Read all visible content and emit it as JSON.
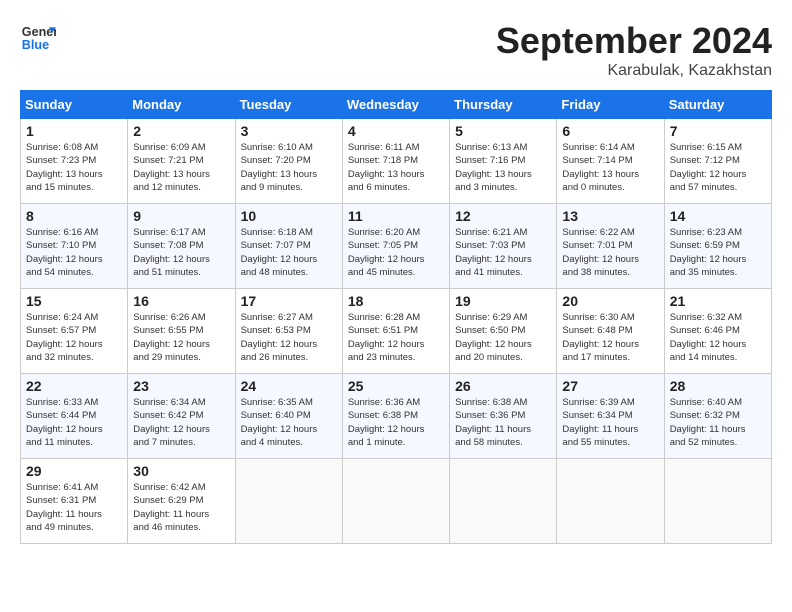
{
  "logo": {
    "line1": "General",
    "line2": "Blue"
  },
  "title": "September 2024",
  "location": "Karabulak, Kazakhstan",
  "weekdays": [
    "Sunday",
    "Monday",
    "Tuesday",
    "Wednesday",
    "Thursday",
    "Friday",
    "Saturday"
  ],
  "days": [
    {
      "day": "",
      "info": ""
    },
    {
      "day": "",
      "info": ""
    },
    {
      "day": "",
      "info": ""
    },
    {
      "day": "",
      "info": ""
    },
    {
      "day": "",
      "info": ""
    },
    {
      "day": "",
      "info": ""
    },
    {
      "day": "1",
      "info": "Sunrise: 6:08 AM\nSunset: 7:23 PM\nDaylight: 13 hours\nand 15 minutes."
    },
    {
      "day": "2",
      "info": "Sunrise: 6:09 AM\nSunset: 7:21 PM\nDaylight: 13 hours\nand 12 minutes."
    },
    {
      "day": "3",
      "info": "Sunrise: 6:10 AM\nSunset: 7:20 PM\nDaylight: 13 hours\nand 9 minutes."
    },
    {
      "day": "4",
      "info": "Sunrise: 6:11 AM\nSunset: 7:18 PM\nDaylight: 13 hours\nand 6 minutes."
    },
    {
      "day": "5",
      "info": "Sunrise: 6:13 AM\nSunset: 7:16 PM\nDaylight: 13 hours\nand 3 minutes."
    },
    {
      "day": "6",
      "info": "Sunrise: 6:14 AM\nSunset: 7:14 PM\nDaylight: 13 hours\nand 0 minutes."
    },
    {
      "day": "7",
      "info": "Sunrise: 6:15 AM\nSunset: 7:12 PM\nDaylight: 12 hours\nand 57 minutes."
    },
    {
      "day": "8",
      "info": "Sunrise: 6:16 AM\nSunset: 7:10 PM\nDaylight: 12 hours\nand 54 minutes."
    },
    {
      "day": "9",
      "info": "Sunrise: 6:17 AM\nSunset: 7:08 PM\nDaylight: 12 hours\nand 51 minutes."
    },
    {
      "day": "10",
      "info": "Sunrise: 6:18 AM\nSunset: 7:07 PM\nDaylight: 12 hours\nand 48 minutes."
    },
    {
      "day": "11",
      "info": "Sunrise: 6:20 AM\nSunset: 7:05 PM\nDaylight: 12 hours\nand 45 minutes."
    },
    {
      "day": "12",
      "info": "Sunrise: 6:21 AM\nSunset: 7:03 PM\nDaylight: 12 hours\nand 41 minutes."
    },
    {
      "day": "13",
      "info": "Sunrise: 6:22 AM\nSunset: 7:01 PM\nDaylight: 12 hours\nand 38 minutes."
    },
    {
      "day": "14",
      "info": "Sunrise: 6:23 AM\nSunset: 6:59 PM\nDaylight: 12 hours\nand 35 minutes."
    },
    {
      "day": "15",
      "info": "Sunrise: 6:24 AM\nSunset: 6:57 PM\nDaylight: 12 hours\nand 32 minutes."
    },
    {
      "day": "16",
      "info": "Sunrise: 6:26 AM\nSunset: 6:55 PM\nDaylight: 12 hours\nand 29 minutes."
    },
    {
      "day": "17",
      "info": "Sunrise: 6:27 AM\nSunset: 6:53 PM\nDaylight: 12 hours\nand 26 minutes."
    },
    {
      "day": "18",
      "info": "Sunrise: 6:28 AM\nSunset: 6:51 PM\nDaylight: 12 hours\nand 23 minutes."
    },
    {
      "day": "19",
      "info": "Sunrise: 6:29 AM\nSunset: 6:50 PM\nDaylight: 12 hours\nand 20 minutes."
    },
    {
      "day": "20",
      "info": "Sunrise: 6:30 AM\nSunset: 6:48 PM\nDaylight: 12 hours\nand 17 minutes."
    },
    {
      "day": "21",
      "info": "Sunrise: 6:32 AM\nSunset: 6:46 PM\nDaylight: 12 hours\nand 14 minutes."
    },
    {
      "day": "22",
      "info": "Sunrise: 6:33 AM\nSunset: 6:44 PM\nDaylight: 12 hours\nand 11 minutes."
    },
    {
      "day": "23",
      "info": "Sunrise: 6:34 AM\nSunset: 6:42 PM\nDaylight: 12 hours\nand 7 minutes."
    },
    {
      "day": "24",
      "info": "Sunrise: 6:35 AM\nSunset: 6:40 PM\nDaylight: 12 hours\nand 4 minutes."
    },
    {
      "day": "25",
      "info": "Sunrise: 6:36 AM\nSunset: 6:38 PM\nDaylight: 12 hours\nand 1 minute."
    },
    {
      "day": "26",
      "info": "Sunrise: 6:38 AM\nSunset: 6:36 PM\nDaylight: 11 hours\nand 58 minutes."
    },
    {
      "day": "27",
      "info": "Sunrise: 6:39 AM\nSunset: 6:34 PM\nDaylight: 11 hours\nand 55 minutes."
    },
    {
      "day": "28",
      "info": "Sunrise: 6:40 AM\nSunset: 6:32 PM\nDaylight: 11 hours\nand 52 minutes."
    },
    {
      "day": "29",
      "info": "Sunrise: 6:41 AM\nSunset: 6:31 PM\nDaylight: 11 hours\nand 49 minutes."
    },
    {
      "day": "30",
      "info": "Sunrise: 6:42 AM\nSunset: 6:29 PM\nDaylight: 11 hours\nand 46 minutes."
    },
    {
      "day": "",
      "info": ""
    },
    {
      "day": "",
      "info": ""
    },
    {
      "day": "",
      "info": ""
    },
    {
      "day": "",
      "info": ""
    },
    {
      "day": "",
      "info": ""
    }
  ]
}
